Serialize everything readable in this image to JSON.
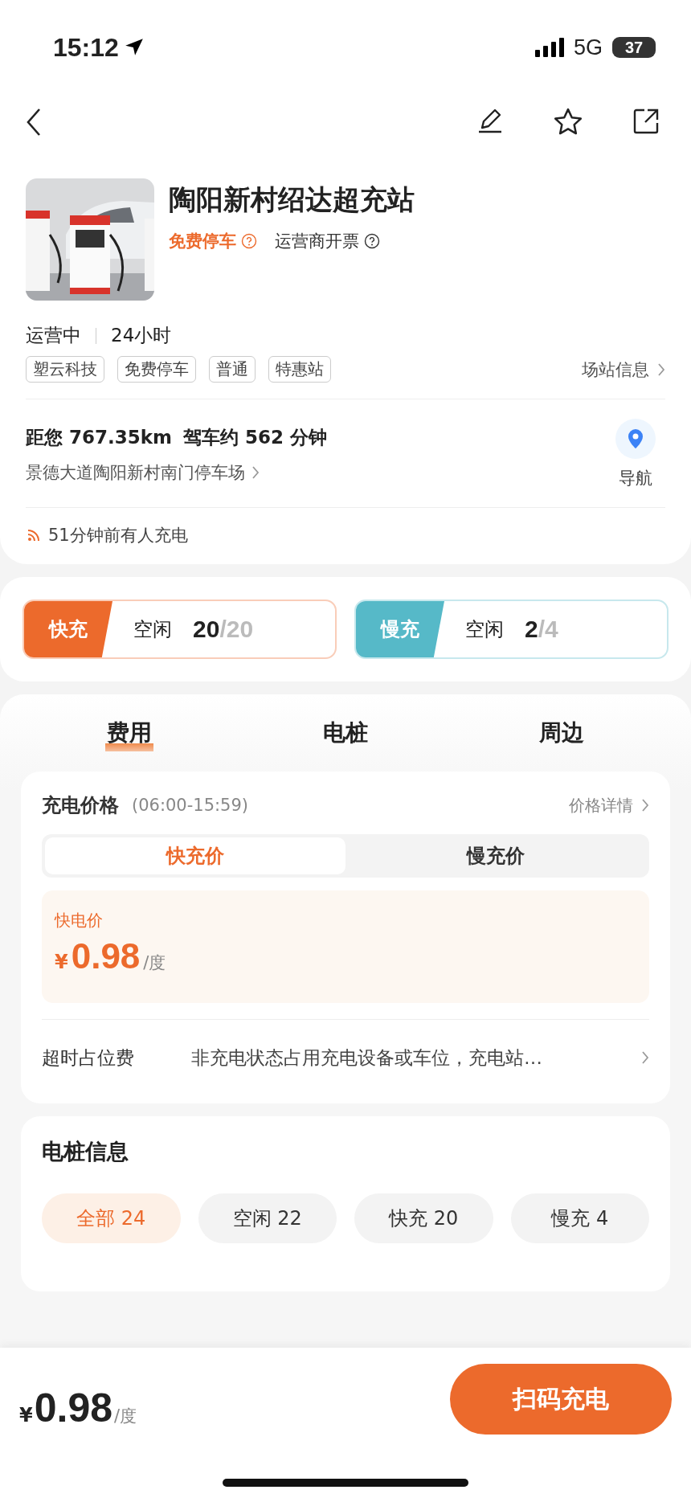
{
  "status_bar": {
    "time": "15:12",
    "network": "5G",
    "battery": "37"
  },
  "station": {
    "name": "陶阳新村绍达超充站",
    "badges": [
      {
        "text": "免费停车",
        "kind": "highlight"
      },
      {
        "text": "运营商开票",
        "kind": "plain"
      }
    ],
    "status": "运营中",
    "hours": "24小时",
    "tags": [
      "塑云科技",
      "免费停车",
      "普通",
      "特惠站"
    ],
    "info_link": "场站信息"
  },
  "location": {
    "distance": "距您 767.35km",
    "drive": "驾车约 562 分钟",
    "address": "景德大道陶阳新村南门停车场",
    "nav_label": "导航"
  },
  "recent": "51分钟前有人充电",
  "chargers": [
    {
      "type": "快充",
      "color": "#ec6a2c",
      "label": "空闲",
      "free": "20",
      "total": "/20"
    },
    {
      "type": "慢充",
      "color": "#56b9c8",
      "label": "空闲",
      "free": "2",
      "total": "/4"
    }
  ],
  "tabs": [
    {
      "label": "费用",
      "selected": true
    },
    {
      "label": "电桩",
      "selected": false
    },
    {
      "label": "周边",
      "selected": false
    }
  ],
  "price": {
    "title": "充电价格",
    "period": "(06:00-15:59)",
    "details_link": "价格详情",
    "modes": [
      {
        "label": "快充价",
        "selected": true
      },
      {
        "label": "慢充价",
        "selected": false
      }
    ],
    "box_label": "快电价",
    "currency": "¥",
    "amount": "0.98",
    "unit": "/度"
  },
  "overtime": {
    "label": "超时占位费",
    "text": "非充电状态占用充电设备或车位，充电站…"
  },
  "piles": {
    "title": "电桩信息",
    "filters": [
      {
        "label": "全部 24",
        "selected": true
      },
      {
        "label": "空闲 22",
        "selected": false
      },
      {
        "label": "快充 20",
        "selected": false
      },
      {
        "label": "慢充 4",
        "selected": false
      }
    ]
  },
  "bottom_bar": {
    "currency": "¥",
    "amount": "0.98",
    "unit": "/度",
    "button": "扫码充电"
  }
}
